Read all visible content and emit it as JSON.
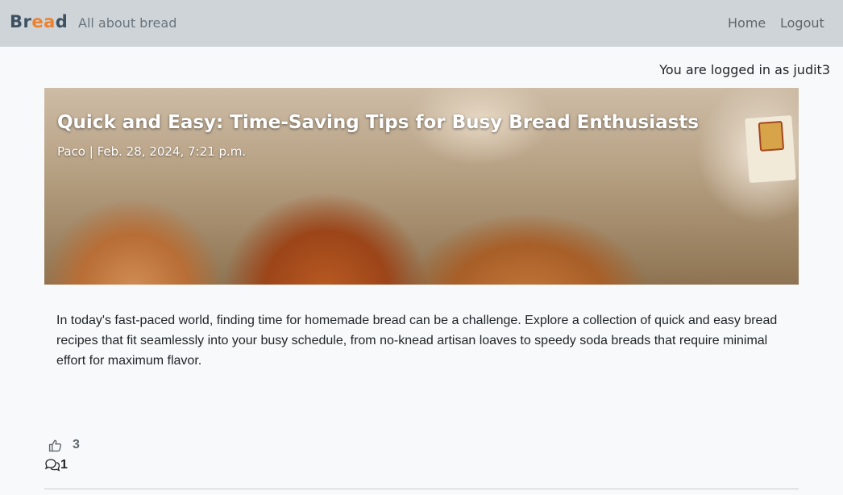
{
  "navbar": {
    "brand": {
      "part1": "Br",
      "part2": "ea",
      "part3": "d"
    },
    "tagline": "All about bread",
    "links": {
      "home": "Home",
      "logout": "Logout"
    },
    "background": "#ced4d7",
    "brand_colors": {
      "primary": "#3d5163",
      "accent": "#f0802c"
    }
  },
  "user_status": "You are logged in as judit3",
  "post": {
    "title": "Quick and Easy: Time-Saving Tips for Busy Bread Enthusiasts",
    "meta": "Paco | Feb. 28, 2024, 7:21 p.m.",
    "body": "In today's fast-paced world, finding time for homemade bread can be a challenge. Explore a collection of quick and easy bread recipes that fit seamlessly into your busy schedule, from no-knead artisan loaves to speedy soda breads that require minimal effort for maximum flavor.",
    "likes": "3",
    "comments": "1",
    "icons": {
      "like": "thumbs-up-icon",
      "comment": "comments-icon"
    }
  }
}
